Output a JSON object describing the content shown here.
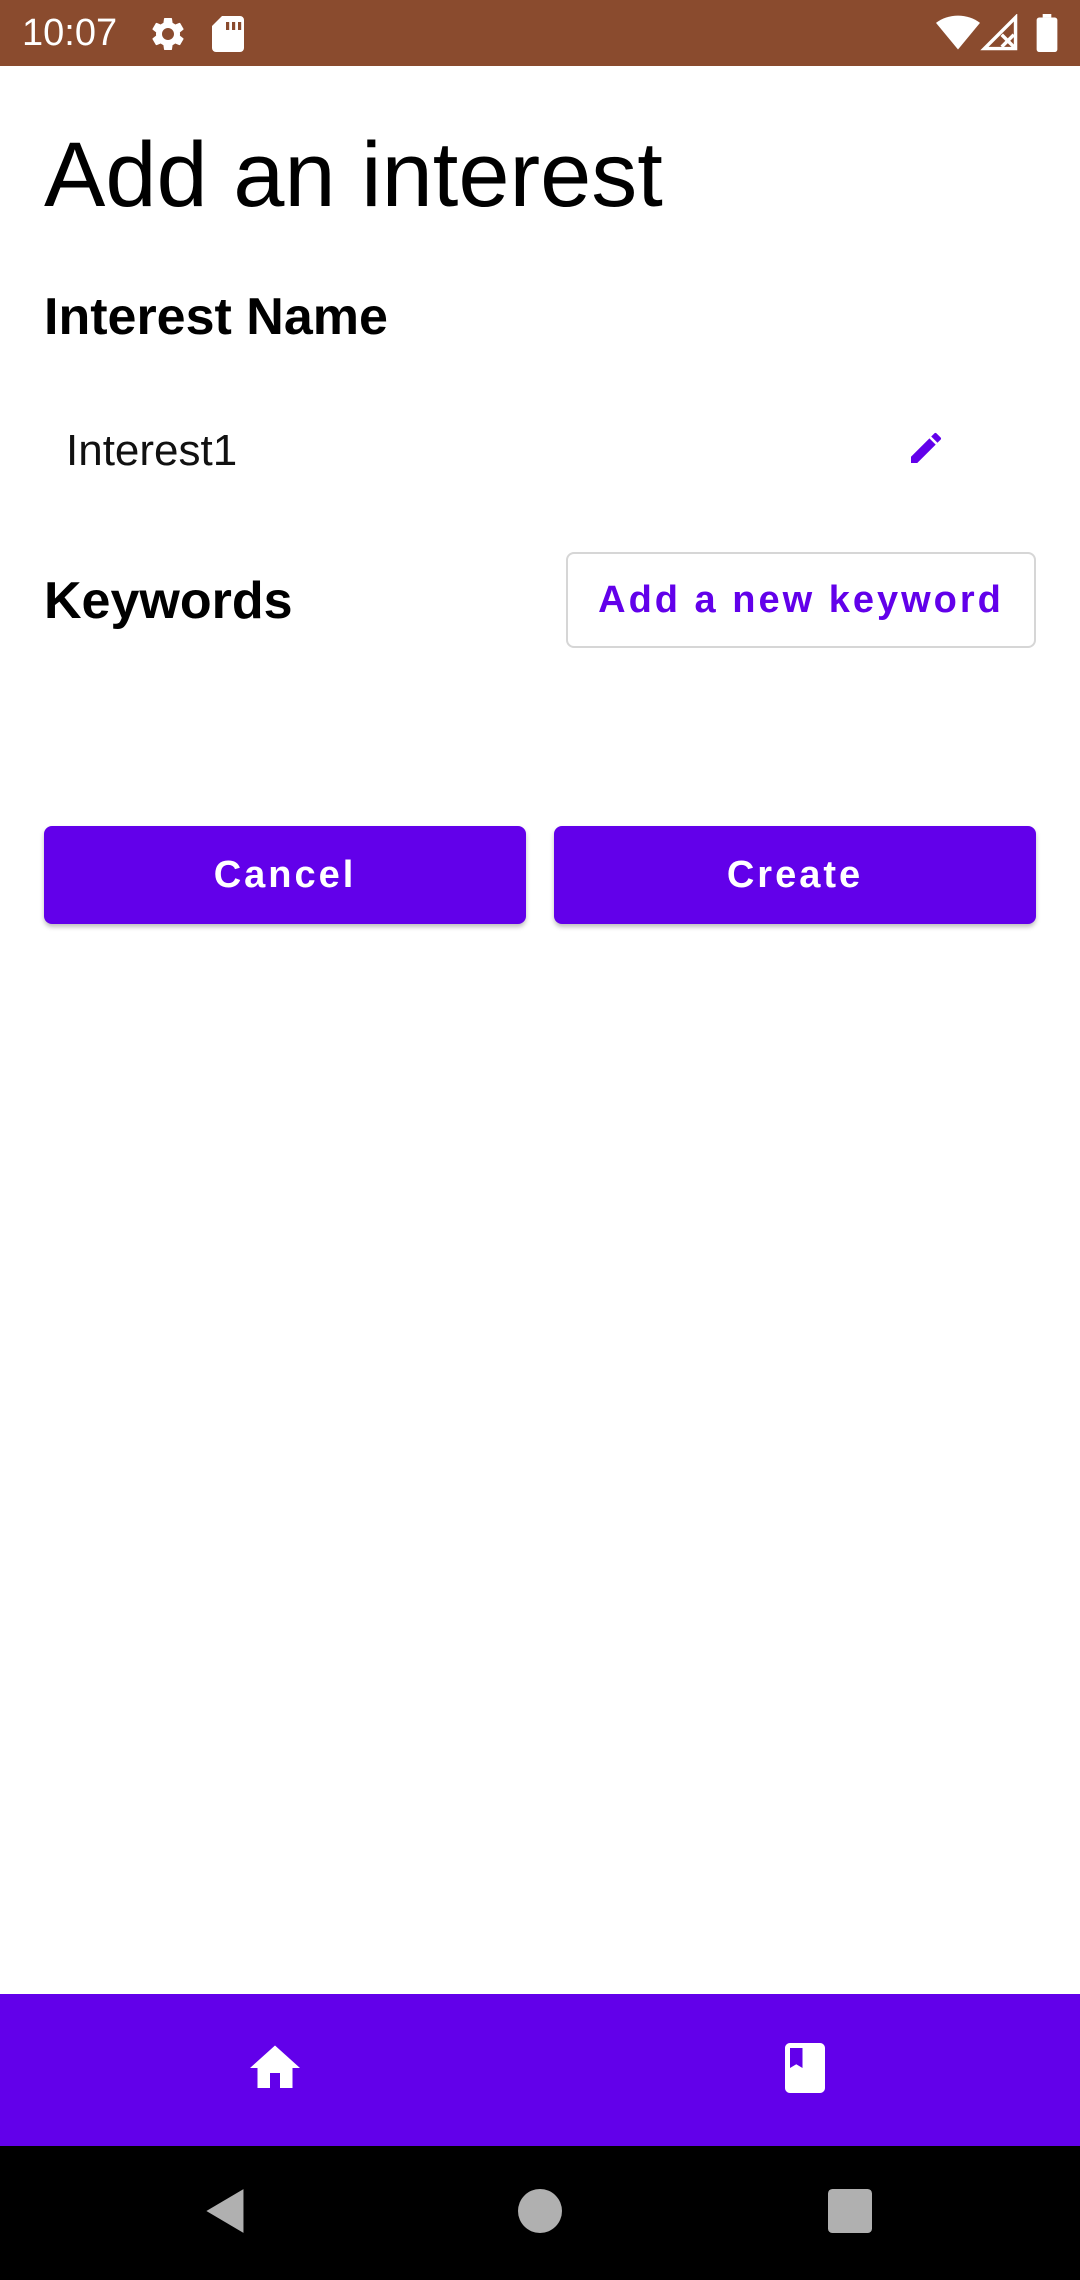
{
  "status_bar": {
    "time": "10:07",
    "icons": [
      "settings-icon",
      "sd-card-icon",
      "wifi-icon",
      "signal-off-icon",
      "battery-icon"
    ],
    "background": "#8a4b2e"
  },
  "page": {
    "title": "Add an interest"
  },
  "interest_name": {
    "label": "Interest Name",
    "value": "Interest1",
    "edit_icon": "edit-icon"
  },
  "keywords": {
    "label": "Keywords",
    "add_button_label": "Add a new keyword"
  },
  "actions": {
    "cancel_label": "Cancel",
    "create_label": "Create"
  },
  "bottom_nav": {
    "items": [
      {
        "icon": "home-icon"
      },
      {
        "icon": "bookmark-book-icon"
      }
    ]
  },
  "system_nav": {
    "items": [
      "back-icon",
      "home-circle-icon",
      "recents-icon"
    ]
  },
  "colors": {
    "accent": "#6200ea",
    "status_bar": "#8a4b2e",
    "text": "#000000"
  }
}
